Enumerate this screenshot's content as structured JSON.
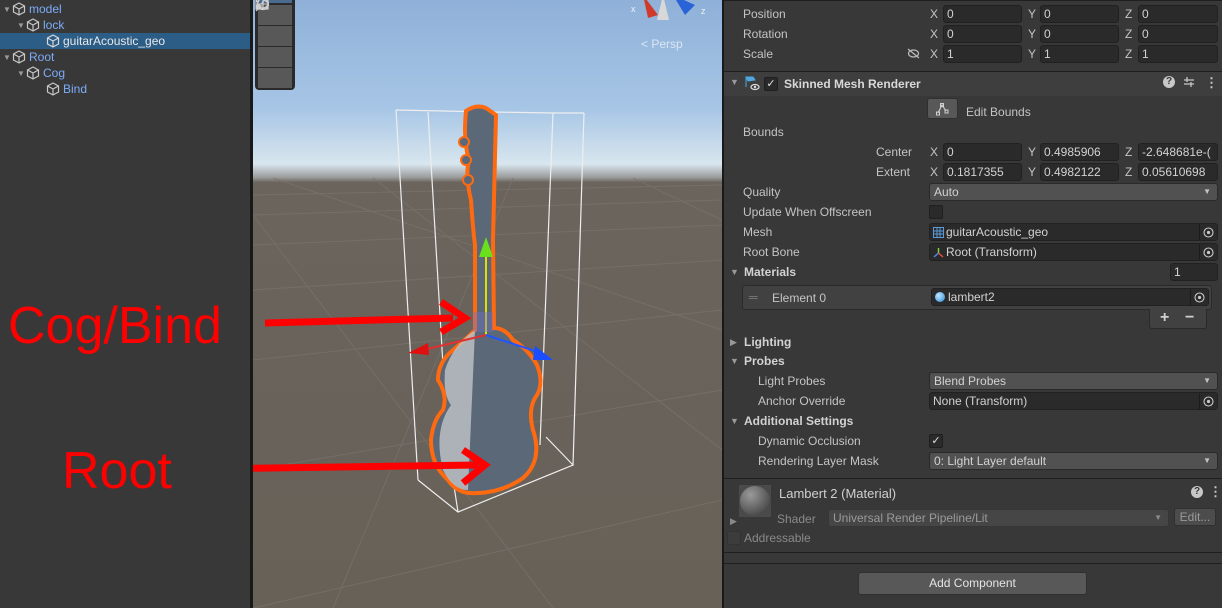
{
  "hierarchy": {
    "items": [
      {
        "label": "model",
        "depth": 0,
        "expanded": true,
        "selected": false
      },
      {
        "label": "lock",
        "depth": 1,
        "expanded": true,
        "selected": false
      },
      {
        "label": "guitarAcoustic_geo",
        "depth": 2,
        "expanded": null,
        "selected": true
      },
      {
        "label": "Root",
        "depth": 0,
        "expanded": true,
        "selected": false
      },
      {
        "label": "Cog",
        "depth": 1,
        "expanded": true,
        "selected": false
      },
      {
        "label": "Bind",
        "depth": 2,
        "expanded": null,
        "selected": false
      }
    ]
  },
  "viewport": {
    "tools": [
      "rotate-tool",
      "scale-tool",
      "rect-tool",
      "transform-tool"
    ],
    "projection_label": "Persp",
    "gizmo_axes": {
      "x": "x",
      "z": "z"
    },
    "annotations": [
      {
        "text": "Cog/Bind",
        "color": "#ff0000"
      },
      {
        "text": "Root",
        "color": "#ff0000"
      }
    ]
  },
  "inspector": {
    "transform": {
      "rows": [
        {
          "label": "Position",
          "x": "0",
          "y": "0",
          "z": "0"
        },
        {
          "label": "Rotation",
          "x": "0",
          "y": "0",
          "z": "0"
        },
        {
          "label": "Scale",
          "x": "1",
          "y": "1",
          "z": "1"
        }
      ],
      "axis_labels": {
        "x": "X",
        "y": "Y",
        "z": "Z"
      }
    },
    "skinned_mesh_renderer": {
      "title": "Skinned Mesh Renderer",
      "enabled": true,
      "edit_bounds_label": "Edit Bounds",
      "bounds_label": "Bounds",
      "center": {
        "label": "Center",
        "x": "0",
        "y": "0.4985906",
        "z": "-2.648681e-("
      },
      "extent": {
        "label": "Extent",
        "x": "0.1817355",
        "y": "0.4982122",
        "z": "0.05610698"
      },
      "quality": {
        "label": "Quality",
        "value": "Auto"
      },
      "update_offscreen": {
        "label": "Update When Offscreen",
        "checked": false
      },
      "mesh": {
        "label": "Mesh",
        "value": "guitarAcoustic_geo"
      },
      "root_bone": {
        "label": "Root Bone",
        "value": "Root (Transform)"
      },
      "materials": {
        "label": "Materials",
        "count": "1",
        "elements": [
          {
            "label": "Element 0",
            "value": "lambert2"
          }
        ]
      },
      "add_label": "+",
      "remove_label": "−",
      "lighting_label": "Lighting",
      "probes": {
        "label": "Probes",
        "light_probes": {
          "label": "Light Probes",
          "value": "Blend Probes"
        },
        "anchor_override": {
          "label": "Anchor Override",
          "value": "None (Transform)"
        }
      },
      "additional": {
        "label": "Additional Settings",
        "dynamic_occlusion": {
          "label": "Dynamic Occlusion",
          "checked": true
        },
        "rendering_layer_mask": {
          "label": "Rendering Layer Mask",
          "value": "0: Light Layer default"
        }
      }
    },
    "material": {
      "title": "Lambert 2 (Material)",
      "shader_label": "Shader",
      "shader_value": "Universal Render Pipeline/Lit",
      "edit_label": "Edit...",
      "addressable_label": "Addressable",
      "addressable_checked": false
    },
    "add_component_label": "Add Component"
  }
}
